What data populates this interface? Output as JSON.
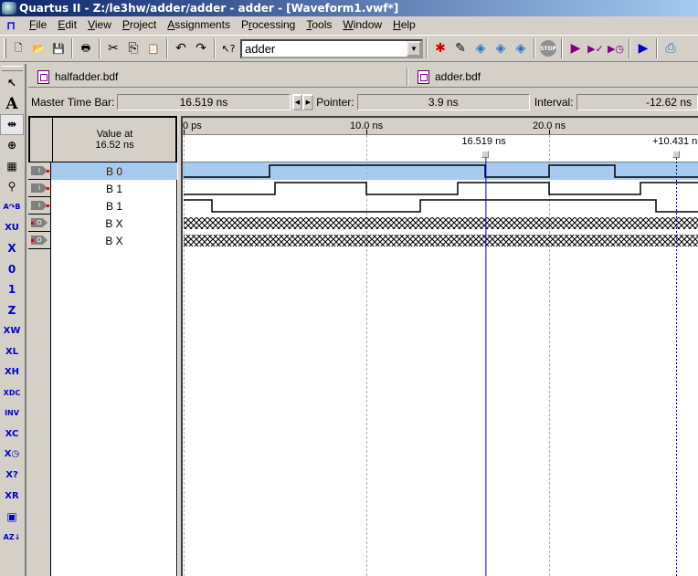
{
  "window": {
    "title": "Quartus II - Z:/le3hw/adder/adder - adder - [Waveform1.vwf*]"
  },
  "menu": [
    {
      "label": "File",
      "mnemonic": "F",
      "rest": "ile"
    },
    {
      "label": "Edit",
      "mnemonic": "E",
      "rest": "dit"
    },
    {
      "label": "View",
      "mnemonic": "V",
      "rest": "iew"
    },
    {
      "label": "Project",
      "mnemonic": "P",
      "rest": "roject"
    },
    {
      "label": "Assignments",
      "mnemonic": "A",
      "rest": "ssignments"
    },
    {
      "label": "Processing",
      "mnemonic": "r",
      "pre": "P",
      "rest": "ocessing"
    },
    {
      "label": "Tools",
      "mnemonic": "T",
      "rest": "ools"
    },
    {
      "label": "Window",
      "mnemonic": "W",
      "rest": "indow"
    },
    {
      "label": "Help",
      "mnemonic": "H",
      "rest": "elp"
    }
  ],
  "toolbar": {
    "buttons_left": [
      {
        "name": "new-icon",
        "glyph": "🗋"
      },
      {
        "name": "open-icon",
        "glyph": "📂"
      },
      {
        "name": "save-icon",
        "glyph": "💾"
      },
      {
        "sep": true
      },
      {
        "name": "print-icon",
        "glyph": "🖶"
      },
      {
        "sep": true
      },
      {
        "name": "cut-icon",
        "glyph": "✂"
      },
      {
        "name": "copy-icon",
        "glyph": "⎘"
      },
      {
        "name": "paste-icon",
        "glyph": "📋"
      },
      {
        "sep": true
      },
      {
        "name": "undo-icon",
        "glyph": "↶"
      },
      {
        "name": "redo-icon",
        "glyph": "↷"
      },
      {
        "sep": true
      },
      {
        "name": "context-help-icon",
        "glyph": "↖?"
      }
    ],
    "project_combo": "adder",
    "buttons_right": [
      {
        "name": "compile-star-icon",
        "glyph": "✱",
        "color": "#d00000"
      },
      {
        "name": "edit-pencil-icon",
        "glyph": "✎",
        "color": "#000000"
      },
      {
        "name": "analysis-icon",
        "glyph": "◈",
        "color": "#3070c0"
      },
      {
        "name": "fitter-icon",
        "glyph": "◈",
        "color": "#3070c0"
      },
      {
        "name": "timing-analyzer-icon",
        "glyph": "◈",
        "color": "#3070c0"
      },
      {
        "sep": true
      },
      {
        "name": "stop-icon",
        "glyph": "STOP",
        "color": "#808080"
      },
      {
        "sep": true
      },
      {
        "name": "start-compilation-icon",
        "glyph": "▶",
        "color": "#800080"
      },
      {
        "name": "start-analysis-icon",
        "glyph": "▶✓",
        "color": "#800080"
      },
      {
        "name": "start-timing-icon",
        "glyph": "▶◷",
        "color": "#800080"
      },
      {
        "sep": true
      },
      {
        "name": "start-simulation-icon",
        "glyph": "▶",
        "color": "#0000c0"
      },
      {
        "sep": true
      },
      {
        "name": "programmer-icon",
        "glyph": "⎙",
        "color": "#3070c0"
      }
    ]
  },
  "left_tools": [
    {
      "name": "selection-tool-icon",
      "glyph": "↖",
      "black": true
    },
    {
      "name": "text-tool-icon",
      "glyph": "A",
      "black": true
    },
    {
      "name": "waveform-editing-tool-icon",
      "glyph": "⇹",
      "black": true,
      "active": true
    },
    {
      "name": "zoom-tool-icon",
      "glyph": "⊕",
      "black": true
    },
    {
      "name": "full-screen-icon",
      "glyph": "▦",
      "black": true
    },
    {
      "name": "find-icon",
      "glyph": "⚲",
      "black": true
    },
    {
      "name": "replace-icon",
      "glyph": "A↷B",
      "black": false
    },
    {
      "name": "uninitialized-icon",
      "glyph": "XU"
    },
    {
      "name": "forcing-unknown-icon",
      "glyph": "X"
    },
    {
      "name": "forcing-low-icon",
      "glyph": "0"
    },
    {
      "name": "forcing-high-icon",
      "glyph": "1"
    },
    {
      "name": "high-impedance-icon",
      "glyph": "Z"
    },
    {
      "name": "weak-unknown-icon",
      "glyph": "XW"
    },
    {
      "name": "weak-low-icon",
      "glyph": "XL"
    },
    {
      "name": "weak-high-icon",
      "glyph": "XH"
    },
    {
      "name": "dont-care-icon",
      "glyph": "XDC"
    },
    {
      "name": "invert-icon",
      "glyph": "INV"
    },
    {
      "name": "count-value-icon",
      "glyph": "XC"
    },
    {
      "name": "overwrite-clock-icon",
      "glyph": "X◷"
    },
    {
      "name": "arbitrary-value-icon",
      "glyph": "X?"
    },
    {
      "name": "random-values-icon",
      "glyph": "XR"
    },
    {
      "name": "snap-to-grid-icon",
      "glyph": "▣"
    },
    {
      "name": "sort-icon",
      "glyph": "AZ↓"
    }
  ],
  "tabs": [
    {
      "label": "halfadder.bdf"
    },
    {
      "label": "adder.bdf"
    }
  ],
  "time_bar": {
    "master_label": "Master Time Bar:",
    "master_value": "16.519 ns",
    "pointer_label": "Pointer:",
    "pointer_value": "3.9 ns",
    "interval_label": "Interval:",
    "interval_value": "-12.62 ns"
  },
  "signal_table": {
    "value_header_line1": "Value at",
    "value_header_line2": "16.52 ns",
    "rows": [
      {
        "type": "input",
        "pin_letter": "I",
        "value": "B 0",
        "selected": true
      },
      {
        "type": "input",
        "pin_letter": "I",
        "value": "B 1",
        "selected": false
      },
      {
        "type": "input",
        "pin_letter": "I",
        "value": "B 1",
        "selected": false
      },
      {
        "type": "output",
        "pin_letter": "O",
        "value": "B X",
        "selected": false
      },
      {
        "type": "output",
        "pin_letter": "O",
        "value": "B X",
        "selected": false
      }
    ]
  },
  "waveform": {
    "ruler_ticks": [
      {
        "ns": 0,
        "label": "0 ps"
      },
      {
        "ns": 10,
        "label": "10.0 ns"
      },
      {
        "ns": 20,
        "label": "20.0 ns"
      }
    ],
    "visible_range_ns": [
      0,
      28.15
    ],
    "master_time_bar": {
      "ns": 16.519,
      "label": "16.519 ns",
      "color": "#0000ff"
    },
    "secondary_time_bar": {
      "ns": 26.95,
      "label": "+10.431 ns",
      "color": "#0000c0"
    },
    "selected_row_color": "#a6caf0",
    "signals": [
      {
        "kind": "digital",
        "initial": 0,
        "transitions_ns": [
          4.7,
          16.5,
          20.0,
          23.6
        ]
      },
      {
        "kind": "digital",
        "initial": 0,
        "transitions_ns": [
          5.0,
          10.0,
          15.0,
          20.0,
          25.0
        ]
      },
      {
        "kind": "digital",
        "initial": 1,
        "transitions_ns": [
          1.55,
          12.95,
          25.85
        ]
      },
      {
        "kind": "unknown"
      },
      {
        "kind": "unknown"
      }
    ]
  }
}
